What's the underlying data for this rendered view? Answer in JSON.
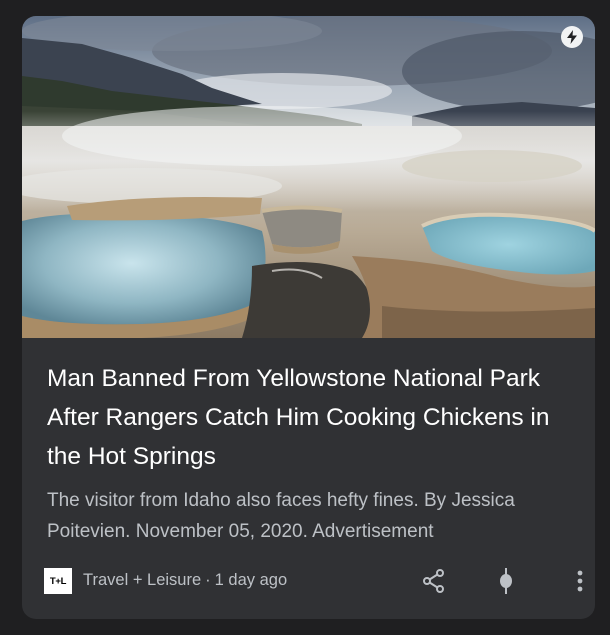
{
  "article": {
    "headline": "Man Banned From Yellowstone National Park After Rangers Catch Him Cooking Chickens in the Hot Springs",
    "snippet": "The visitor from Idaho also faces hefty fines. By Jessica Poitevien. November 05, 2020. Advertisement",
    "image_alt": "Steaming travertine terraces of Yellowstone hot springs under cloudy sky"
  },
  "source": {
    "logo_text": "T+L",
    "name": "Travel + Leisure",
    "separator": "·",
    "age": "1 day ago"
  },
  "icons": {
    "amp": "lightning-bolt-icon",
    "share": "share-icon",
    "pin": "pin-icon",
    "more": "more-vertical-icon"
  },
  "colors": {
    "background": "#1f1f21",
    "card": "#303134",
    "headline": "#ffffff",
    "secondary_text": "#bdc1c6"
  }
}
